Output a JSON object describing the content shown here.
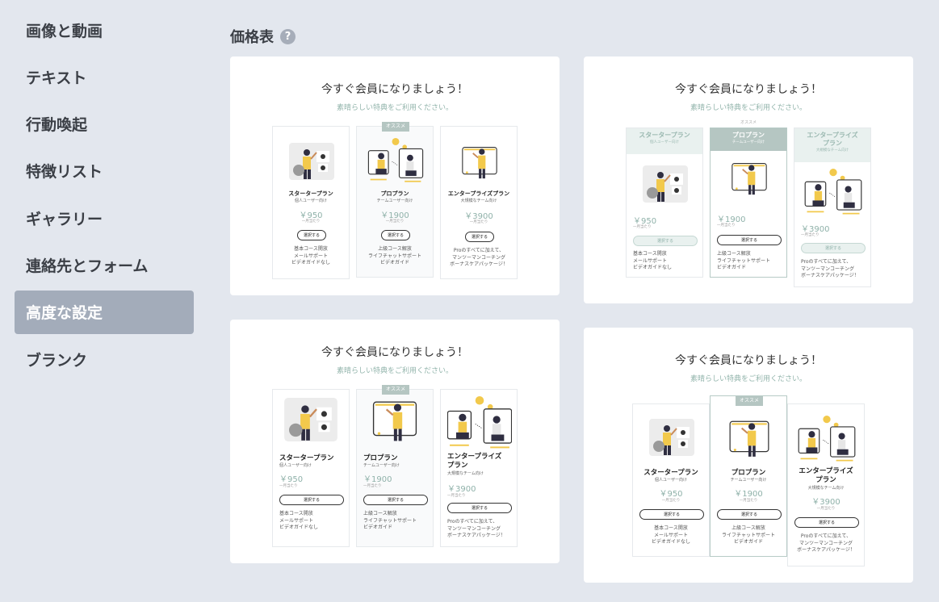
{
  "sidebar": {
    "items": [
      {
        "label": "画像と動画"
      },
      {
        "label": "テキスト"
      },
      {
        "label": "行動喚起"
      },
      {
        "label": "特徴リスト"
      },
      {
        "label": "ギャラリー"
      },
      {
        "label": "連絡先とフォーム"
      },
      {
        "label": "高度な設定"
      },
      {
        "label": "ブランク"
      }
    ],
    "active_index": 6
  },
  "section": {
    "title": "価格表",
    "help_icon": "question-circle-icon"
  },
  "template": {
    "heading": "今すぐ会員になりましょう！",
    "subheading": "素晴らしい特典をご利用ください。",
    "badge": "オススメ",
    "button": "選択する",
    "per": "一月当たり",
    "plans": [
      {
        "name": "スタータープラン",
        "tagline": "個人ユーザー向け",
        "price": "￥950",
        "features": [
          "基本コース開放",
          "メールサポート",
          "ビデオガイドなし"
        ]
      },
      {
        "name": "プロプラン",
        "tagline": "チームユーザー向け",
        "price": "￥1900",
        "features": [
          "上級コース解放",
          "ライフチャットサポート",
          "ビデオガイド"
        ]
      },
      {
        "name": "エンタープライズプラン",
        "name_wrapped": "エンタープライズ\nプラン",
        "tagline": "大規模なチーム向け",
        "price": "￥3900",
        "features": [
          "Proのすべてに加えて、",
          "マンツーマンコーチング",
          "ボーナスケアパッケージ！"
        ]
      }
    ]
  },
  "colors": {
    "accent": "#93b5ac",
    "badge": "#b5c6c2",
    "sidebar_active": "#a3acba",
    "background": "#e3e7ee"
  }
}
